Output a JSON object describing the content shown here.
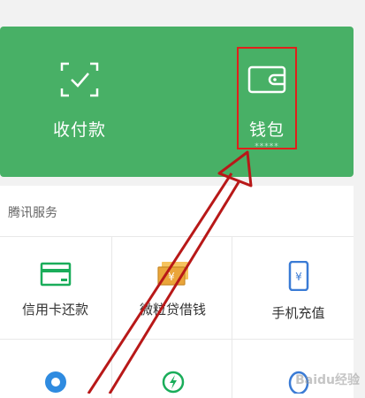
{
  "top_panel": {
    "pay_label": "收付款",
    "wallet_label": "钱包",
    "wallet_balance_mask": "*****"
  },
  "services": {
    "section_title": "腾讯服务",
    "items": [
      {
        "label": "信用卡还款",
        "icon": "credit-card-icon",
        "color": "#1aad5a"
      },
      {
        "label": "微粒贷借钱",
        "icon": "banknote-icon",
        "color": "#e8a33c"
      },
      {
        "label": "手机充值",
        "icon": "phone-topup-icon",
        "color": "#3a7bd5"
      }
    ]
  },
  "colors": {
    "panel_green": "#48b066",
    "highlight_red": "#e0201a"
  },
  "watermark": "Baidu经验"
}
